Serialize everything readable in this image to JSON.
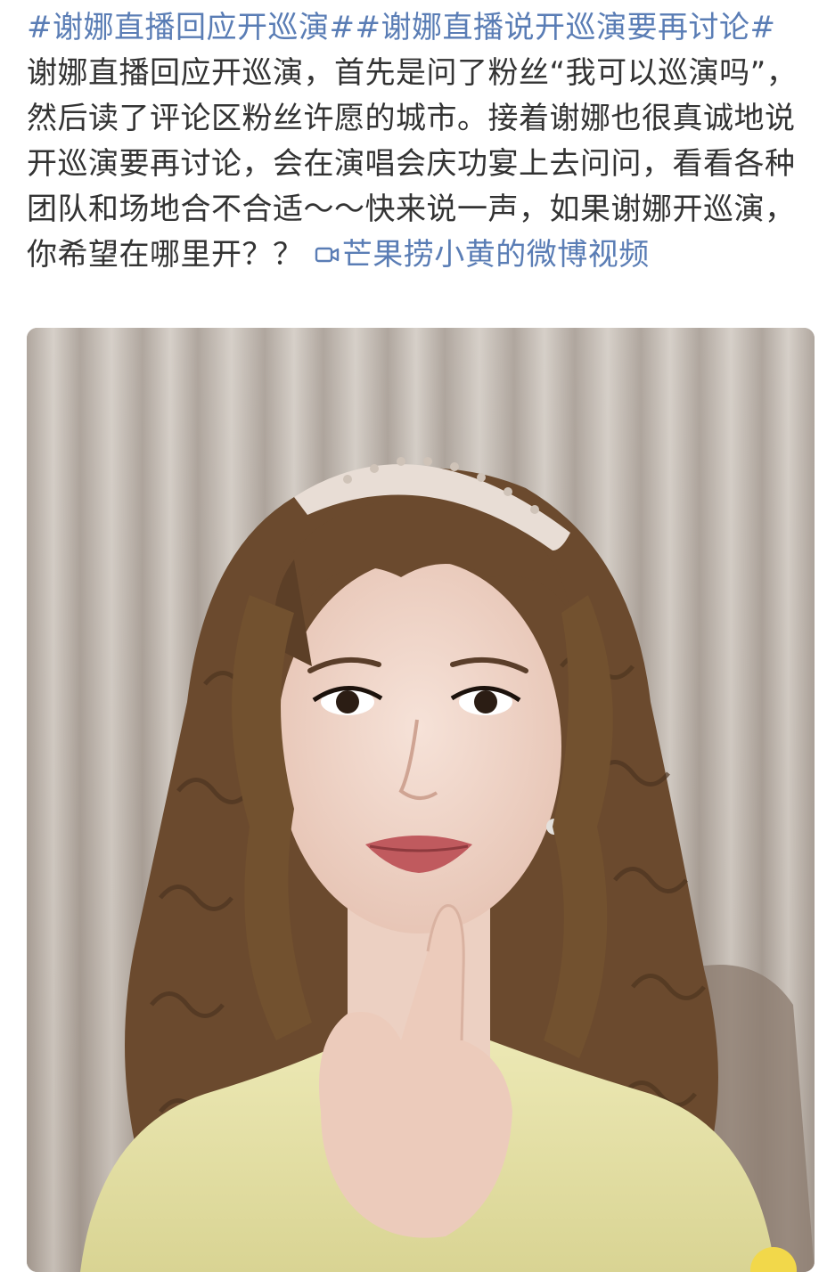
{
  "post": {
    "topic_1": "#谢娜直播回应开巡演#",
    "topic_2": "#谢娜直播说开巡演要再讨论#",
    "body": " 谢娜直播回应开巡演，首先是问了粉丝“我可以巡演吗”，然后读了评论区粉丝许愿的城市。接着谢娜也很真诚地说开巡演要再讨论，会在演唱会庆功宴上去问问，看看各种团队和场地合不合适～～快来说一声，如果谢娜开巡演，你希望在哪里开？？ ",
    "video_link_label": "芒果捞小黄的微博视频",
    "video_link_icon": "video-camera-icon"
  },
  "video": {
    "thumbnail_description_icon": "video-thumbnail",
    "colors": {
      "link": "#5a7db5",
      "text": "#333333",
      "curtain": "#b9b0a8",
      "shirt": "#e4e0a0",
      "hair": "#6b4a2e"
    }
  }
}
